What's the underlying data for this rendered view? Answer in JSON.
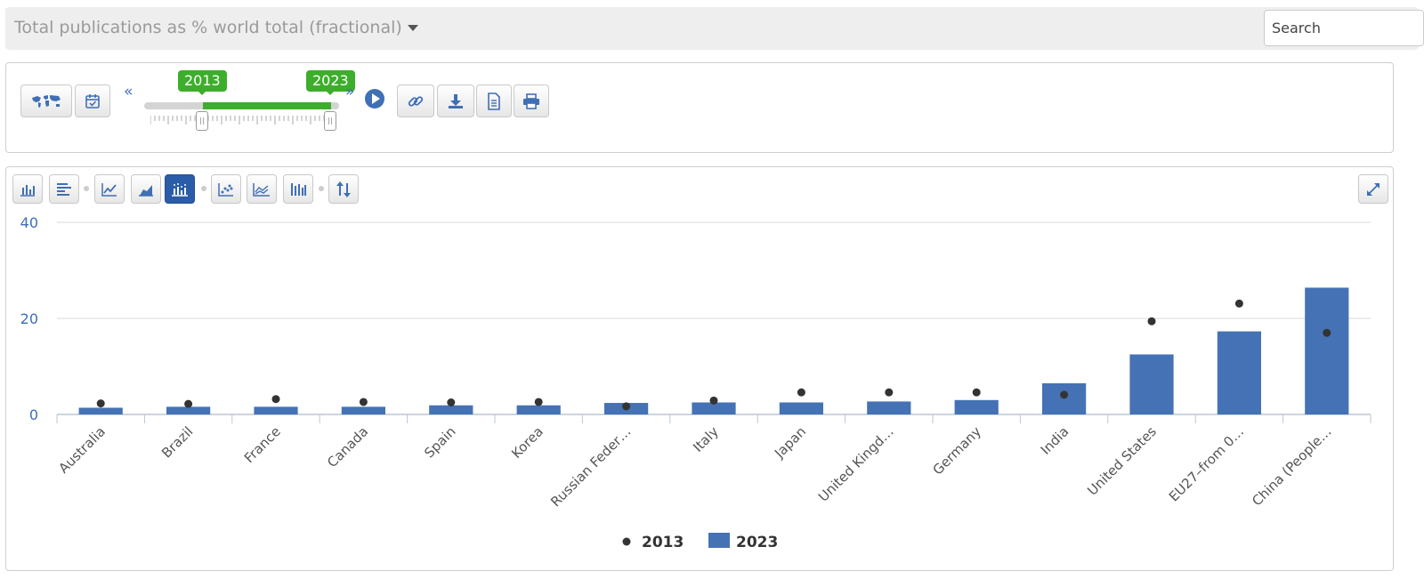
{
  "header": {
    "indicator_label": "Total publications as % world total (fractional)",
    "search_placeholder": "Search"
  },
  "timeline": {
    "start_year": "2013",
    "end_year": "2023",
    "prev_glyph": "«",
    "next_glyph": "»"
  },
  "colors": {
    "accent": "#3f6fb5",
    "bar": "#4472b4",
    "dot": "#333333",
    "slider_green": "#3dae2b",
    "active_button": "#2a5ca8"
  },
  "chart_data": {
    "type": "bar",
    "title": "",
    "xlabel": "",
    "ylabel": "",
    "ylim": [
      0,
      40
    ],
    "yticks": [
      "0",
      "20",
      "40"
    ],
    "grid": true,
    "legend_position": "bottom",
    "categories": [
      "Australia",
      "Brazil",
      "France",
      "Canada",
      "Spain",
      "Korea",
      "Russian Feder…",
      "Italy",
      "Japan",
      "United Kingd…",
      "Germany",
      "India",
      "United States",
      "EU27–from 0…",
      "China (People…"
    ],
    "series": [
      {
        "name": "2023",
        "kind": "bar",
        "values": [
          1.4,
          1.6,
          1.6,
          1.6,
          1.9,
          1.9,
          2.4,
          2.5,
          2.5,
          2.7,
          3.0,
          6.5,
          12.5,
          17.3,
          26.4
        ]
      },
      {
        "name": "2013",
        "kind": "dot",
        "values": [
          2.3,
          2.2,
          3.2,
          2.6,
          2.5,
          2.6,
          1.7,
          2.9,
          4.6,
          4.6,
          4.6,
          4.1,
          19.4,
          23.1,
          17.0
        ]
      }
    ]
  }
}
